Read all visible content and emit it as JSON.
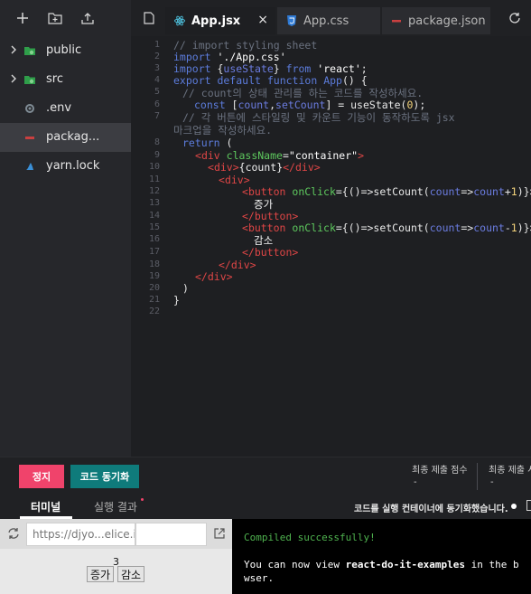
{
  "sidebar": {
    "items": [
      {
        "label": "public",
        "type": "folder"
      },
      {
        "label": "src",
        "type": "folder"
      },
      {
        "label": ".env",
        "type": "config"
      },
      {
        "label": "packag...",
        "type": "package"
      },
      {
        "label": "yarn.lock",
        "type": "yarn"
      }
    ]
  },
  "tabs": [
    {
      "label": "App.jsx",
      "icon": "react-icon"
    },
    {
      "label": "App.css",
      "icon": "css-icon"
    },
    {
      "label": "package.json",
      "icon": "json-icon"
    }
  ],
  "tab_close": "×",
  "editor": {
    "line_numbers": [
      "1",
      "2",
      "3",
      "4",
      "5",
      "6",
      "7",
      "",
      "8",
      "9",
      "10",
      "11",
      "12",
      "13",
      "14",
      "15",
      "16",
      "17",
      "18",
      "19",
      "20",
      "21",
      "22"
    ],
    "l1": "// import styling sheet",
    "l2_kw": "import",
    "l2_str": "'./App.css'",
    "l3_kw": "import",
    "l3_brace_open": " {",
    "l3_var": "useState",
    "l3_brace_close": "} ",
    "l3_from": "from",
    "l3_str": "'react'",
    "l3_semi": ";",
    "l4_kw": "export default function",
    "l4_fn": "App",
    "l4_rest": "() {",
    "l5": "// count의 상태 관리를 하는 코드를 작성하세요.",
    "l6_kw": "const",
    "l6_open": " [",
    "l6_v1": "count",
    "l6_comma": ",",
    "l6_v2": "setCount",
    "l6_close": "] = useState(",
    "l6_num": "0",
    "l6_end": ");",
    "l7a": "// 각 버튼에 스타일링 및 카운트 기능이 동작하도록 jsx",
    "l7b": "마크업을 작성하세요.",
    "l8_kw": "return",
    "l8_rest": " (",
    "l9_lt": "<",
    "l9_tag": "div",
    "l9_attr": " className",
    "l9_eq": "=",
    "l9_str": "\"container\"",
    "l9_gt": ">",
    "l10_lt": "<",
    "l10_tag": "div",
    "l10_gt": ">",
    "l10_txt": "{count}",
    "l10_clt": "</",
    "l10_ctag": "div",
    "l10_cgt": ">",
    "l11_lt": "<",
    "l11_tag": "div",
    "l11_gt": ">",
    "l12_lt": "<",
    "l12_tag": "button",
    "l12_attr": " onClick",
    "l12_a": "={()=>setCount(",
    "l12_v1": "count",
    "l12_b": "=>",
    "l12_v2": "count",
    "l12_c": "+",
    "l12_num": "1",
    "l12_d": ")}>",
    "l13": "증가",
    "l14_lt": "</",
    "l14_tag": "button",
    "l14_gt": ">",
    "l15_lt": "<",
    "l15_tag": "button",
    "l15_attr": " onClick",
    "l15_a": "={()=>setCount(",
    "l15_v1": "count",
    "l15_b": "=>",
    "l15_v2": "count",
    "l15_c": "-",
    "l15_num": "1",
    "l15_d": ")}>",
    "l16": "감소",
    "l17_lt": "</",
    "l17_tag": "button",
    "l17_gt": ">",
    "l18_lt": "</",
    "l18_tag": "div",
    "l18_gt": ">",
    "l19_lt": "</",
    "l19_tag": "div",
    "l19_gt": ">",
    "l20": ")",
    "l21": "}",
    "l22": ""
  },
  "controls": {
    "stop_label": "정지",
    "sync_label": "코드 동기화",
    "final_score_label": "최종 제출 점수",
    "final_score_value": "-",
    "final_submit_label": "최종 제출 시",
    "final_submit_value": "-"
  },
  "bottom_tabs": {
    "terminal": "터미널",
    "result": "실행 결과",
    "sync_status": "코드를 실행 컨테이너에 동기화했습니다."
  },
  "preview": {
    "url": "https://djyo...elice.io/",
    "count": "3",
    "increment_label": "증가",
    "decrement_label": "감소"
  },
  "terminal": {
    "line1": "Compiled successfully!",
    "line2_pre": "You can now view ",
    "line2_bold": "react-do-it-examples",
    "line2_post": " in the b",
    "line3": "wser."
  },
  "colors": {
    "stop_button": "#f0436b",
    "sync_button": "#0f7b7b",
    "terminal_success": "#4fb34f"
  }
}
